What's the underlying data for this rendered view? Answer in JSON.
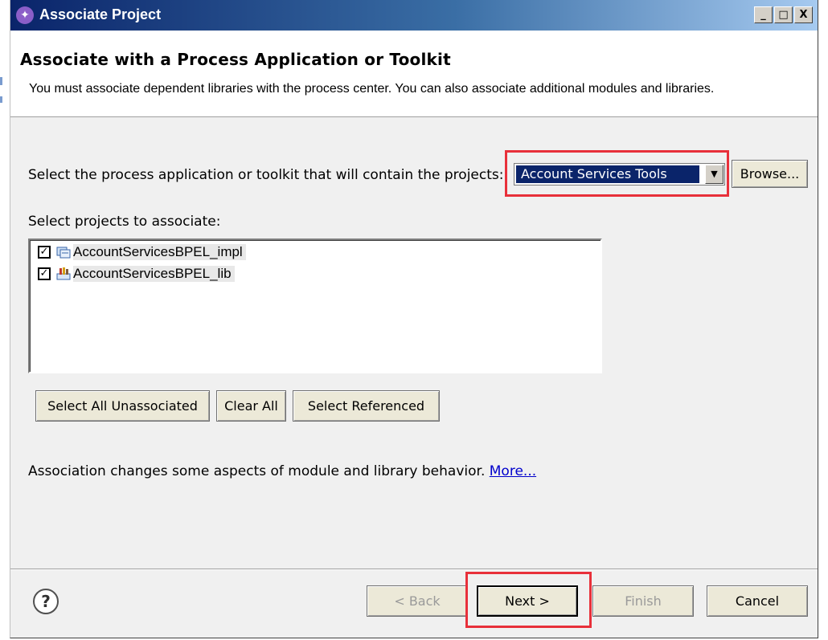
{
  "window": {
    "title": "Associate Project",
    "caption_buttons": [
      "_",
      "□",
      "X"
    ]
  },
  "banner": {
    "title": "Associate with a Process Application or Toolkit",
    "description": "You must associate dependent libraries with the process center. You can also associate additional modules and libraries."
  },
  "container": {
    "label": "Select the process application or toolkit that will contain the projects:",
    "selected": "Account Services Tools",
    "browse_label": "Browse..."
  },
  "projects": {
    "label": "Select projects to associate:",
    "items": [
      {
        "name": "AccountServicesBPEL_impl",
        "checked": true,
        "icon": "module-project-icon"
      },
      {
        "name": "AccountServicesBPEL_lib",
        "checked": true,
        "icon": "library-project-icon"
      }
    ],
    "check_glyph": "✓"
  },
  "actions": {
    "select_all": "Select All Unassociated",
    "clear_all": "Clear All",
    "select_referenced": "Select Referenced"
  },
  "note": {
    "text": "Association changes some aspects of module and library behavior.",
    "link": "More..."
  },
  "footer": {
    "help_glyph": "?",
    "back": "< Back",
    "next": "Next >",
    "finish": "Finish",
    "cancel": "Cancel"
  },
  "colors": {
    "highlight": "#e8303a",
    "selection": "#0a246a",
    "link": "#0000cc"
  }
}
